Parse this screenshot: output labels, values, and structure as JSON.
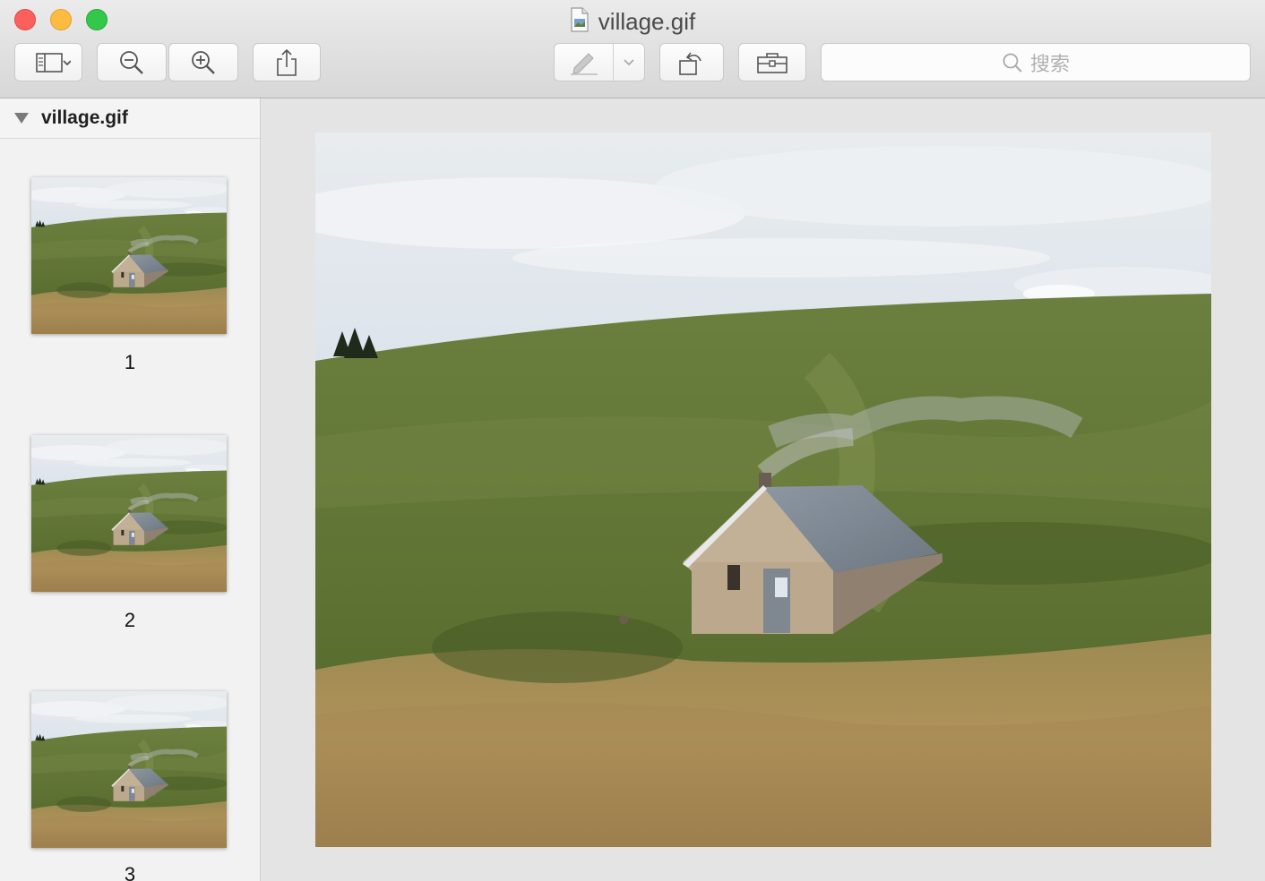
{
  "window": {
    "title": "village.gif"
  },
  "toolbar": {
    "sidebar_toggle_icon": "sidebar-icon",
    "zoom_out_icon": "zoom-out-icon",
    "zoom_in_icon": "zoom-in-icon",
    "share_icon": "share-icon",
    "markup_icon": "pen-icon",
    "rotate_icon": "rotate-left-icon",
    "toolbox_icon": "toolbox-icon",
    "search_placeholder": "搜索"
  },
  "sidebar": {
    "title": "village.gif",
    "pages": [
      {
        "number": "1"
      },
      {
        "number": "2"
      },
      {
        "number": "3"
      }
    ]
  },
  "colors": {
    "close": "#fc605c",
    "minimize": "#fdbc40",
    "maximize": "#34c84a"
  }
}
